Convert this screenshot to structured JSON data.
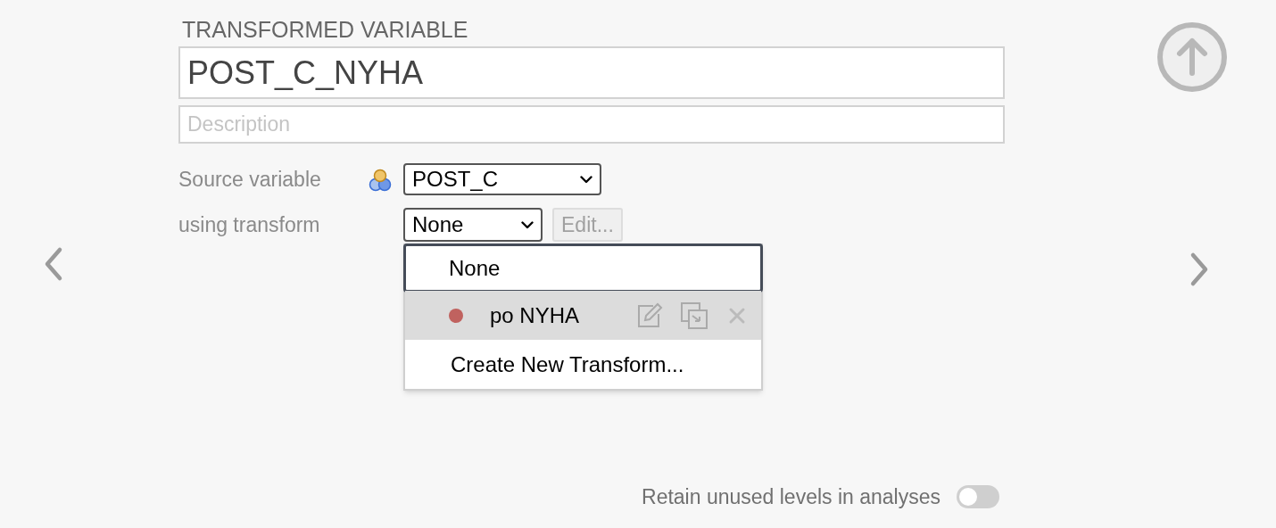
{
  "heading": "TRANSFORMED VARIABLE",
  "name": {
    "value": "POST_C_NYHA"
  },
  "description": {
    "placeholder": "Description"
  },
  "source": {
    "label": "Source variable",
    "value": "POST_C"
  },
  "transform": {
    "label": "using transform",
    "value": "None",
    "edit_button": {
      "label": "Edit...",
      "disabled": true
    }
  },
  "menu": {
    "items": [
      {
        "kind": "option",
        "label": "None",
        "selected": true,
        "hovered": false
      },
      {
        "kind": "transform",
        "label": "po NYHA",
        "color": "#c0625f",
        "selected": false,
        "hovered": true
      },
      {
        "kind": "action",
        "label": "Create New Transform...",
        "selected": false,
        "hovered": false
      }
    ]
  },
  "retain": {
    "label": "Retain unused levels in analyses",
    "on": false
  }
}
